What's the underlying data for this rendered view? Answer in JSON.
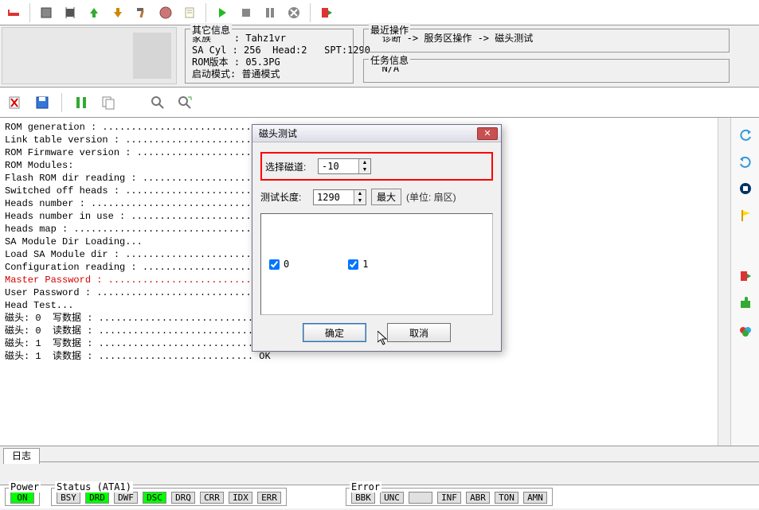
{
  "toolbar_icons": [
    "bed",
    "book",
    "pin",
    "down",
    "up",
    "hammer",
    "globe",
    "note",
    "sep",
    "play",
    "stop",
    "pause",
    "cancel",
    "sep",
    "exit"
  ],
  "info": {
    "other_info": {
      "legend": "其它信息",
      "lines": [
        "家族    : Tahz1vr",
        "SA Cyl : 256  Head:2   SPT:1290",
        "ROM版本 : 05.3PG",
        "启动模式: 普通模式"
      ]
    },
    "recent_ops": {
      "legend": "最近操作",
      "line": "  诊断 -> 服务区操作 -> 磁头测试"
    },
    "task_info": {
      "legend": "任务信息",
      "line": "  N/A"
    }
  },
  "log_lines": [
    {
      "t": "ROM generation : ................................",
      "red": false
    },
    {
      "t": "Link table version : ...........................",
      "red": false
    },
    {
      "t": "ROM Firmware version : .........................",
      "red": false
    },
    {
      "t": "",
      "red": false
    },
    {
      "t": "ROM Modules:",
      "red": false
    },
    {
      "t": "Flash ROM dir reading : ........................",
      "red": false
    },
    {
      "t": "Switched off heads : ...........................",
      "red": false
    },
    {
      "t": "Heads number : .................................",
      "red": false
    },
    {
      "t": "Heads number in use : ..........................",
      "red": false
    },
    {
      "t": "heads map : ....................................",
      "red": false
    },
    {
      "t": "",
      "red": false
    },
    {
      "t": "SA Module Dir Loading...",
      "red": false
    },
    {
      "t": "Load SA Module dir : ...........................",
      "red": false
    },
    {
      "t": "Configuration reading : ........................",
      "red": false
    },
    {
      "t": "Master Password : ..............................",
      "red": true
    },
    {
      "t": "User Password : ................................",
      "red": false
    },
    {
      "t": "",
      "red": false
    },
    {
      "t": "Head Test...",
      "red": false
    },
    {
      "t": "磁头: 0  写数据 : ........................... OK",
      "red": false
    },
    {
      "t": "磁头: 0  读数据 : ........................... OK",
      "red": false
    },
    {
      "t": "磁头: 1  写数据 : ........................... OK",
      "red": false
    },
    {
      "t": "磁头: 1  读数据 : ........................... OK",
      "red": false
    }
  ],
  "dialog": {
    "title": "磁头测试",
    "track_label": "选择磁道:",
    "track_value": "-10",
    "length_label": "测试长度:",
    "length_value": "1290",
    "max_btn": "最大",
    "unit": "(单位: 扇区)",
    "head0": "0",
    "head1": "1",
    "ok": "确定",
    "cancel": "取消"
  },
  "footer_tab": "日志",
  "status": {
    "power_legend": "Power",
    "power_chip": "ON",
    "status_legend": "Status (ATA1)",
    "status_chips": [
      "BSY",
      "DRD",
      "DWF",
      "DSC",
      "DRQ",
      "CRR",
      "IDX",
      "ERR"
    ],
    "error_legend": "Error",
    "error_chips": [
      "BBK",
      "UNC",
      "",
      "INF",
      "ABR",
      "TON",
      "AMN"
    ]
  }
}
